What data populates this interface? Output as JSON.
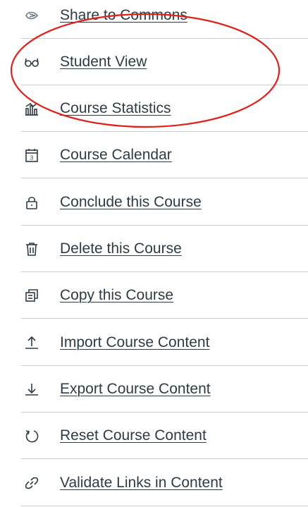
{
  "menu": {
    "items": [
      {
        "label": "Share to Commons",
        "icon": "share-commons-icon"
      },
      {
        "label": "Student View",
        "icon": "student-view-icon"
      },
      {
        "label": "Course Statistics",
        "icon": "statistics-icon"
      },
      {
        "label": "Course Calendar",
        "icon": "calendar-icon"
      },
      {
        "label": "Conclude this Course",
        "icon": "lock-icon"
      },
      {
        "label": "Delete this Course",
        "icon": "trash-icon"
      },
      {
        "label": "Copy this Course",
        "icon": "copy-icon"
      },
      {
        "label": "Import Course Content",
        "icon": "upload-icon"
      },
      {
        "label": "Export Course Content",
        "icon": "download-icon"
      },
      {
        "label": "Reset Course Content",
        "icon": "reset-icon"
      },
      {
        "label": "Validate Links in Content",
        "icon": "link-icon"
      }
    ]
  },
  "calendar_icon_day": "3",
  "colors": {
    "text": "#2d3b45",
    "divider": "#c7cdd1",
    "annotation": "#e0201b"
  }
}
